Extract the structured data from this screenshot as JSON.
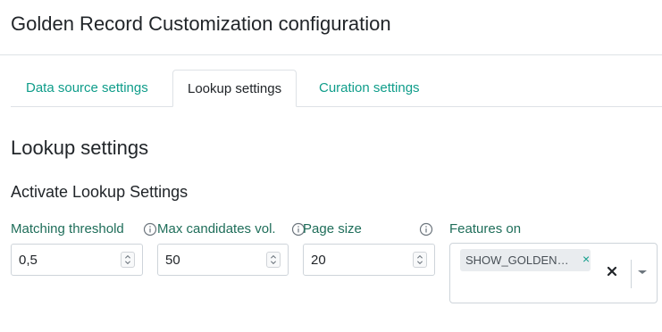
{
  "header": {
    "title": "Golden Record Customization configuration"
  },
  "tabs": [
    {
      "label": "Data source settings",
      "active": false
    },
    {
      "label": "Lookup settings",
      "active": true
    },
    {
      "label": "Curation settings",
      "active": false
    }
  ],
  "section": {
    "title": "Lookup settings",
    "subtitle": "Activate Lookup Settings"
  },
  "fields": {
    "matching_threshold": {
      "label": "Matching threshold",
      "value": "0,5",
      "icon": "info-icon"
    },
    "max_candidates": {
      "label": "Max candidates vol.",
      "value": "50",
      "icon": "info-icon"
    },
    "page_size": {
      "label": "Page size",
      "value": "20",
      "icon": "info-icon"
    },
    "features_on": {
      "label": "Features on",
      "chips": [
        "SHOW_GOLDEN…"
      ]
    }
  },
  "colors": {
    "accent": "#0f9d8a",
    "label": "#1f6e5a",
    "border": "#ced4da"
  }
}
